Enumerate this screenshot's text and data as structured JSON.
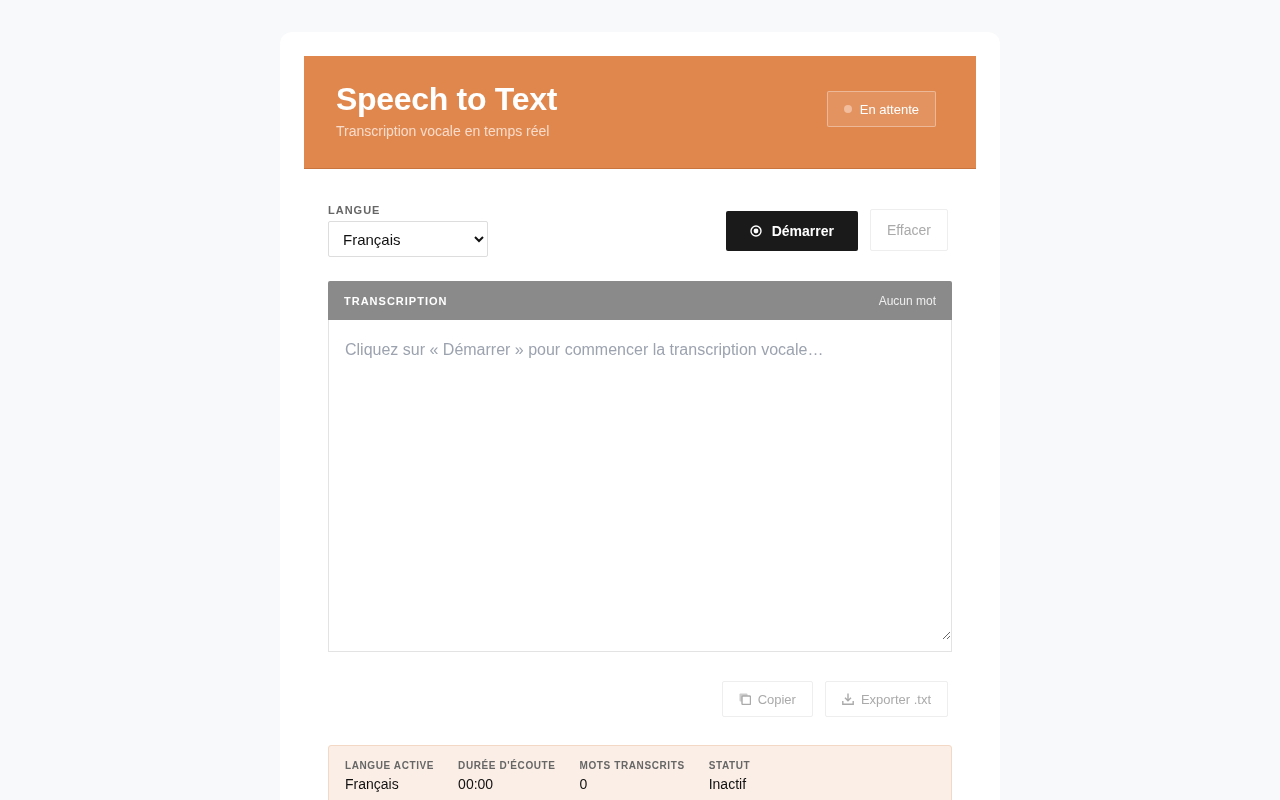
{
  "header": {
    "title": "Speech to Text",
    "subtitle": "Transcription vocale en temps réel",
    "status_badge": "En attente"
  },
  "language": {
    "label": "LANGUE",
    "value": "Français"
  },
  "controls": [
    {
      "label": "Démarrer",
      "kind": "primary",
      "disabled": false
    },
    {
      "label": "Effacer",
      "kind": "secondary",
      "disabled": true
    }
  ],
  "transcription": {
    "title": "TRANSCRIPTION",
    "word_count": "Aucun mot",
    "placeholder": "Cliquez sur « Démarrer » pour commencer la transcription vocale…"
  },
  "actions": [
    {
      "label": "Copier",
      "kind": "copy",
      "disabled": true
    },
    {
      "label": "Exporter .txt",
      "kind": "export",
      "disabled": true
    }
  ],
  "stats": [
    {
      "label": "LANGUE ACTIVE",
      "value": "Français"
    },
    {
      "label": "DURÉE D'ÉCOUTE",
      "value": "00:00"
    },
    {
      "label": "MOTS TRANSCRITS",
      "value": "0"
    },
    {
      "label": "STATUT",
      "value": "Inactif"
    }
  ]
}
